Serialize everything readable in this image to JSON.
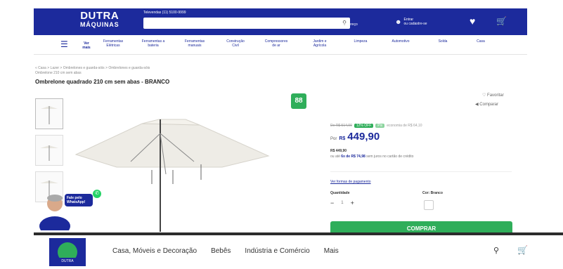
{
  "header": {
    "brand_line1": "DUTRA",
    "brand_line2": "MÁQUINAS",
    "contact": "Televendas (11) 5100-9999",
    "search_placeholder": "",
    "location_line1": "Olá!",
    "location_line2": "seu endereço",
    "account_line1": "Entrar",
    "account_line2": "ou cadastre-se",
    "colors": {
      "primary": "#1c2a9c",
      "accent": "#2fae5a"
    }
  },
  "catnav": {
    "menu_label": "Ver mais",
    "items": [
      "Ferramentas Elétricas",
      "Ferramentas a bateria",
      "Ferramentas manuais",
      "Construção Civil",
      "Compressores de ar",
      "Jardim e Agrícola",
      "Limpeza",
      "Automotivo",
      "Solda",
      "Casa"
    ]
  },
  "breadcrumb": {
    "line1": "« Casa > Lazer > Ombrelones e guarda-sóis > Ombrelones e guarda-sóis",
    "line2": "Ombrelone 210 cm sem abas"
  },
  "product": {
    "title": "Ombrelone quadrado 210 cm sem abas - BRANCO",
    "badge": "88",
    "favorite": "♡ Favoritar",
    "compare": "◀ Comparar",
    "old_price": "De R$ 514,00",
    "discount_tag": "12% OFF",
    "pix_tag": "Pix",
    "discount_note": "economia de R$ 64,10",
    "price_prefix": "Por",
    "currency": "R$",
    "price": "449,90",
    "alt_price": "R$ 449,90",
    "installments_prefix": "ou até",
    "installments": "6x de R$ 74,98",
    "installments_suffix": "sem juros no cartão de crédito",
    "payment_link": "Ver formas de pagamento",
    "qty_label": "Quantidade",
    "qty_minus": "−",
    "qty_value": "1",
    "qty_plus": "+",
    "color_label": "Cor: Branco",
    "buy_label": "COMPRAR"
  },
  "whatsapp": {
    "bubble": "Fale pelo WhatsApp!",
    "icon": "whatsapp-icon"
  },
  "bottombar": {
    "logo_text": "DUTRA",
    "nav": [
      "Casa, Móveis e Decoração",
      "Bebês",
      "Indústria e Comércio",
      "Mais"
    ]
  }
}
